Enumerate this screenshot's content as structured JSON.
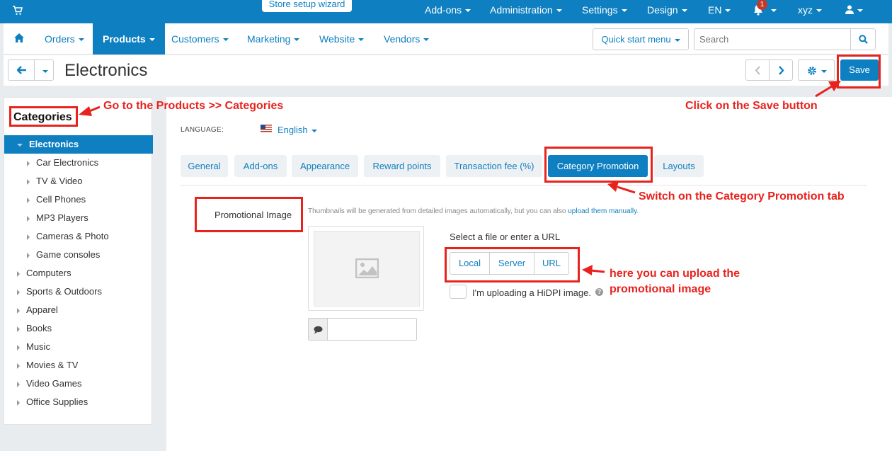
{
  "topbar": {
    "wizard_label": "Store setup wizard",
    "items": [
      "Add-ons",
      "Administration",
      "Settings",
      "Design",
      "EN"
    ],
    "notification_count": "1",
    "user": "xyz"
  },
  "mainnav": {
    "items": [
      "Orders",
      "Products",
      "Customers",
      "Marketing",
      "Website",
      "Vendors"
    ],
    "quick_start": "Quick start menu",
    "search_placeholder": "Search"
  },
  "titlebar": {
    "title": "Electronics",
    "save_label": "Save"
  },
  "sidebar": {
    "heading": "Categories",
    "items": [
      {
        "label": "Electronics",
        "level": 0,
        "active": true
      },
      {
        "label": "Car Electronics",
        "level": 1
      },
      {
        "label": "TV & Video",
        "level": 1
      },
      {
        "label": "Cell Phones",
        "level": 1
      },
      {
        "label": "MP3 Players",
        "level": 1
      },
      {
        "label": "Cameras & Photo",
        "level": 1
      },
      {
        "label": "Game consoles",
        "level": 1
      },
      {
        "label": "Computers",
        "level": 0
      },
      {
        "label": "Sports & Outdoors",
        "level": 0
      },
      {
        "label": "Apparel",
        "level": 0
      },
      {
        "label": "Books",
        "level": 0
      },
      {
        "label": "Music",
        "level": 0
      },
      {
        "label": "Movies & TV",
        "level": 0
      },
      {
        "label": "Video Games",
        "level": 0
      },
      {
        "label": "Office Supplies",
        "level": 0
      }
    ]
  },
  "content": {
    "language_label": "LANGUAGE:",
    "language_value": "English",
    "tabs": [
      "General",
      "Add-ons",
      "Appearance",
      "Reward points",
      "Transaction fee (%)",
      "Category Promotion",
      "Layouts"
    ],
    "active_tab": "Category Promotion",
    "field_label": "Promotional Image",
    "hint_text": "Thumbnails will be generated from detailed images automatically, but you can also ",
    "hint_link": "upload them manually",
    "hint_end": ".",
    "select_label": "Select a file or enter a URL",
    "upload_buttons": [
      "Local",
      "Server",
      "URL"
    ],
    "hidpi_label": "I'm uploading a HiDPI image."
  },
  "annotations": {
    "categories_note": "Go to the Products >> Categories",
    "save_note": "Click on the Save button",
    "tab_note": "Switch on the Category Promotion tab",
    "upload_note_line1": "here you can upload the",
    "upload_note_line2": "promotional image"
  },
  "colors": {
    "brand": "#0e7fc0",
    "annotation": "#e8231e"
  }
}
